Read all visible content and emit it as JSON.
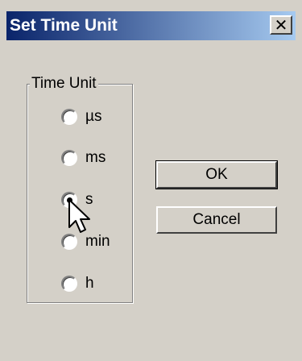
{
  "dialog": {
    "title": "Set Time Unit",
    "close_glyph": "✕"
  },
  "group": {
    "label": "Time Unit",
    "options": [
      {
        "label": "µs",
        "checked": false
      },
      {
        "label": "ms",
        "checked": false
      },
      {
        "label": "s",
        "checked": true
      },
      {
        "label": "min",
        "checked": false
      },
      {
        "label": "h",
        "checked": false
      }
    ]
  },
  "buttons": {
    "ok_label": "OK",
    "cancel_label": "Cancel"
  },
  "icons": {
    "close": "close-icon",
    "cursor": "mouse-pointer-icon"
  },
  "colors": {
    "face": "#d4d0c8",
    "title_start": "#0a246a",
    "title_end": "#a6caf0"
  }
}
